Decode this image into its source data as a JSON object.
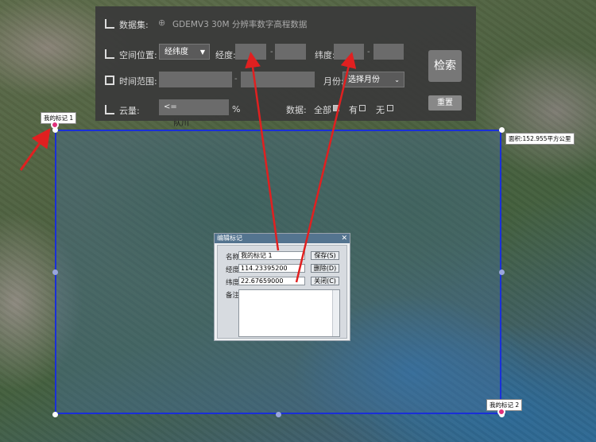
{
  "panel": {
    "dataset": {
      "label": "数据集:",
      "value": "GDEMV3 30M 分辨率数字高程数据"
    },
    "spatial": {
      "label": "空间位置:",
      "select": "经纬度",
      "lon_label": "经度:",
      "lat_label": "纬度:",
      "dash": "-"
    },
    "time": {
      "label": "时间范围:",
      "dash": "-",
      "month_label": "月份:",
      "month_select": "选择月份"
    },
    "cloud": {
      "label": "云量:",
      "op": "<=",
      "unit": "%"
    },
    "data_filter": {
      "label": "数据:",
      "all": "全部",
      "has": "有",
      "none": "无",
      "all_checked": true
    },
    "search_button": "检索",
    "reset_button": "重置"
  },
  "map": {
    "area_label": "面积:152.955平方公里",
    "marker1_label": "我的标记 1",
    "marker2_label": "我的标记 2",
    "street_label": "队川"
  },
  "dialog": {
    "title": "编辑标记",
    "name_label": "名称",
    "name_value": "我的标记 1",
    "lon_label": "经度",
    "lon_value": "114.23395200",
    "lat_label": "纬度",
    "lat_value": "22.67659000",
    "note_label": "备注",
    "save_button": "保存(S)",
    "delete_button": "删除(D)",
    "close_button": "关闭(C)"
  },
  "colors": {
    "aoi_border": "#1a2fd8",
    "annotation_arrow": "#e02020",
    "marker": "#e0307a"
  }
}
